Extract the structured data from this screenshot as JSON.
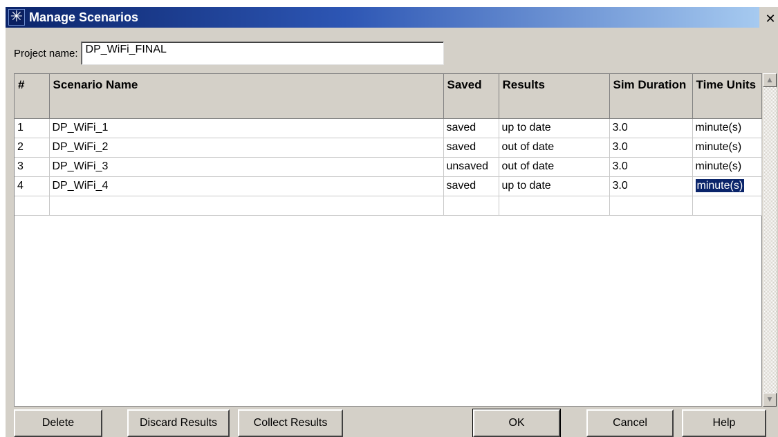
{
  "window": {
    "title": "Manage Scenarios",
    "title_icon": "asterisk-icon",
    "close_label": "✕"
  },
  "project": {
    "label": "Project name:",
    "value": "DP_WiFi_FINAL"
  },
  "table": {
    "headers": [
      "#",
      "Scenario Name",
      "Saved",
      "Results",
      "Sim Duration",
      "Time Units"
    ],
    "rows": [
      [
        "1",
        "DP_WiFi_1",
        "saved",
        "up to date",
        "3.0",
        "minute(s)"
      ],
      [
        "2",
        "DP_WiFi_2",
        "saved",
        "out of date",
        "3.0",
        "minute(s)"
      ],
      [
        "3",
        "DP_WiFi_3",
        "unsaved",
        "out of date",
        "3.0",
        "minute(s)"
      ],
      [
        "4",
        "DP_WiFi_4",
        "saved",
        "up to date",
        "3.0",
        "minute(s)"
      ]
    ],
    "selected_cell": "minute(s)"
  },
  "buttons": {
    "delete": "Delete",
    "discard_results": "Discard Results",
    "collect_results": "Collect Results",
    "ok": "OK",
    "cancel": "Cancel",
    "help": "Help"
  },
  "colors": {
    "titlebar_start": "#0b246a",
    "titlebar_end": "#a6caf0",
    "selection": "#0a246a",
    "dialog_bg": "#d4d0c8"
  }
}
